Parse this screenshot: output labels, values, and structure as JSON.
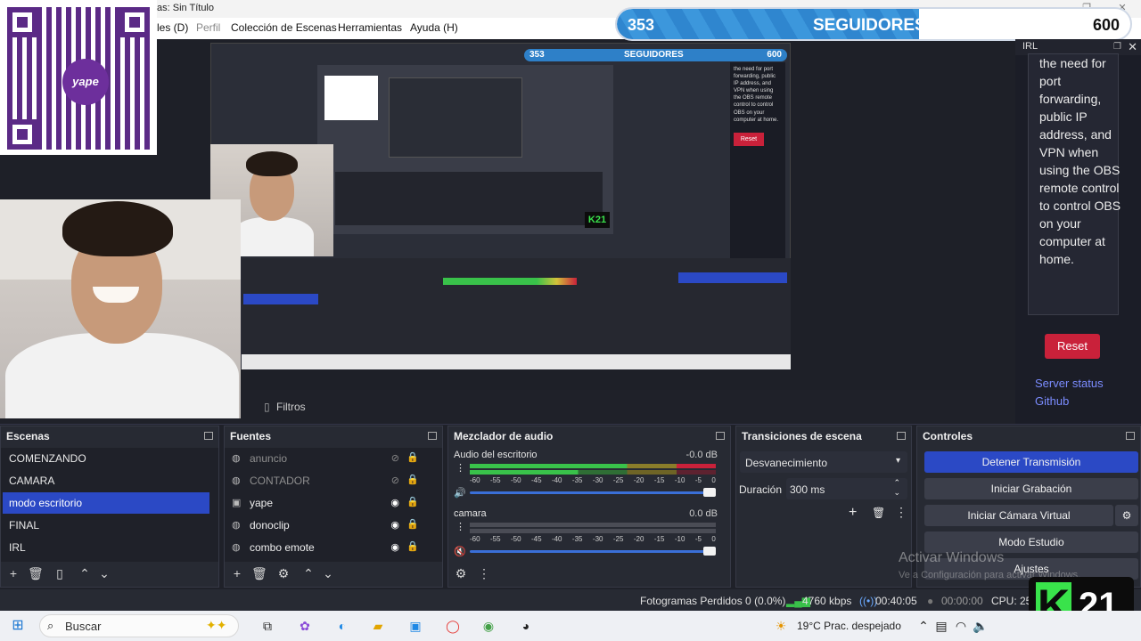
{
  "window": {
    "title": "as: Sin Título",
    "controls": [
      "—",
      "❐",
      "✕"
    ]
  },
  "menu": [
    "les (D)",
    "Perfil",
    "Colección de Escenas",
    "Herramientas",
    "Ayuda (H)"
  ],
  "followers": {
    "current": "353",
    "label": "SEGUIDORES",
    "goal": "600",
    "progress": 0.588
  },
  "qr": {
    "logo_text": "yape"
  },
  "irl": {
    "title": "IRL",
    "body": "the need for port forwarding, public IP address, and VPN when using the OBS remote control to control OBS on your computer at home.",
    "reset_label": "Reset",
    "server_status": "Server status",
    "github": "Github"
  },
  "preview_capture": {
    "counter_current": "353",
    "counter_label": "SEGUIDORES",
    "counter_goal": "600",
    "irl_text": "the need for port forwarding, public IP address, and VPN when using the OBS remote control to control OBS on your computer at home.",
    "reset": "Reset"
  },
  "filters": {
    "label": "Filtros"
  },
  "scenes": {
    "title": "Escenas",
    "items": [
      "COMENZANDO",
      "CAMARA",
      "modo escritorio",
      "FINAL",
      "IRL"
    ],
    "active_index": 2
  },
  "sources": {
    "title": "Fuentes",
    "items": [
      {
        "name": "anuncio",
        "visible": false
      },
      {
        "name": "CONTADOR",
        "visible": false
      },
      {
        "name": "yape",
        "visible": true
      },
      {
        "name": "donoclip",
        "visible": true
      },
      {
        "name": "combo emote",
        "visible": true
      }
    ]
  },
  "mixer": {
    "title": "Mezclador de audio",
    "channels": [
      {
        "name": "Audio del escritorio",
        "db": "-0.0 dB",
        "level": 0.9
      },
      {
        "name": "camara",
        "db": "0.0 dB",
        "level": 0.0
      }
    ],
    "scale": [
      "-60",
      "-55",
      "-50",
      "-45",
      "-40",
      "-35",
      "-30",
      "-25",
      "-20",
      "-15",
      "-10",
      "-5",
      "0"
    ]
  },
  "transitions": {
    "title": "Transiciones de escena",
    "selected": "Desvanecimiento",
    "duration_label": "Duración",
    "duration_value": "300 ms"
  },
  "controls": {
    "title": "Controles",
    "buttons": [
      "Detener Transmisión",
      "Iniciar Grabación",
      "Iniciar Cámara Virtual",
      "Modo Estudio",
      "Ajustes"
    ]
  },
  "status": {
    "dropped": "Fotogramas Perdidos 0 (0.0%)",
    "bitrate": "4760 kbps",
    "live_time": "00:40:05",
    "rec_time": "00:00:00",
    "cpu": "CPU: 25."
  },
  "watermark": {
    "line1": "Activar Windows",
    "line2": "Ve a Configuración para activar Windows."
  },
  "logo": {
    "letter": "K",
    "number": "21"
  },
  "taskbar": {
    "search_placeholder": "Buscar",
    "weather": "19°C  Prac. despejado"
  },
  "colors": {
    "accent": "#2b49c5",
    "reset": "#c9213a",
    "link": "#7b8cff",
    "meter_green": "#39c24a",
    "k21_green": "#39e34b"
  }
}
